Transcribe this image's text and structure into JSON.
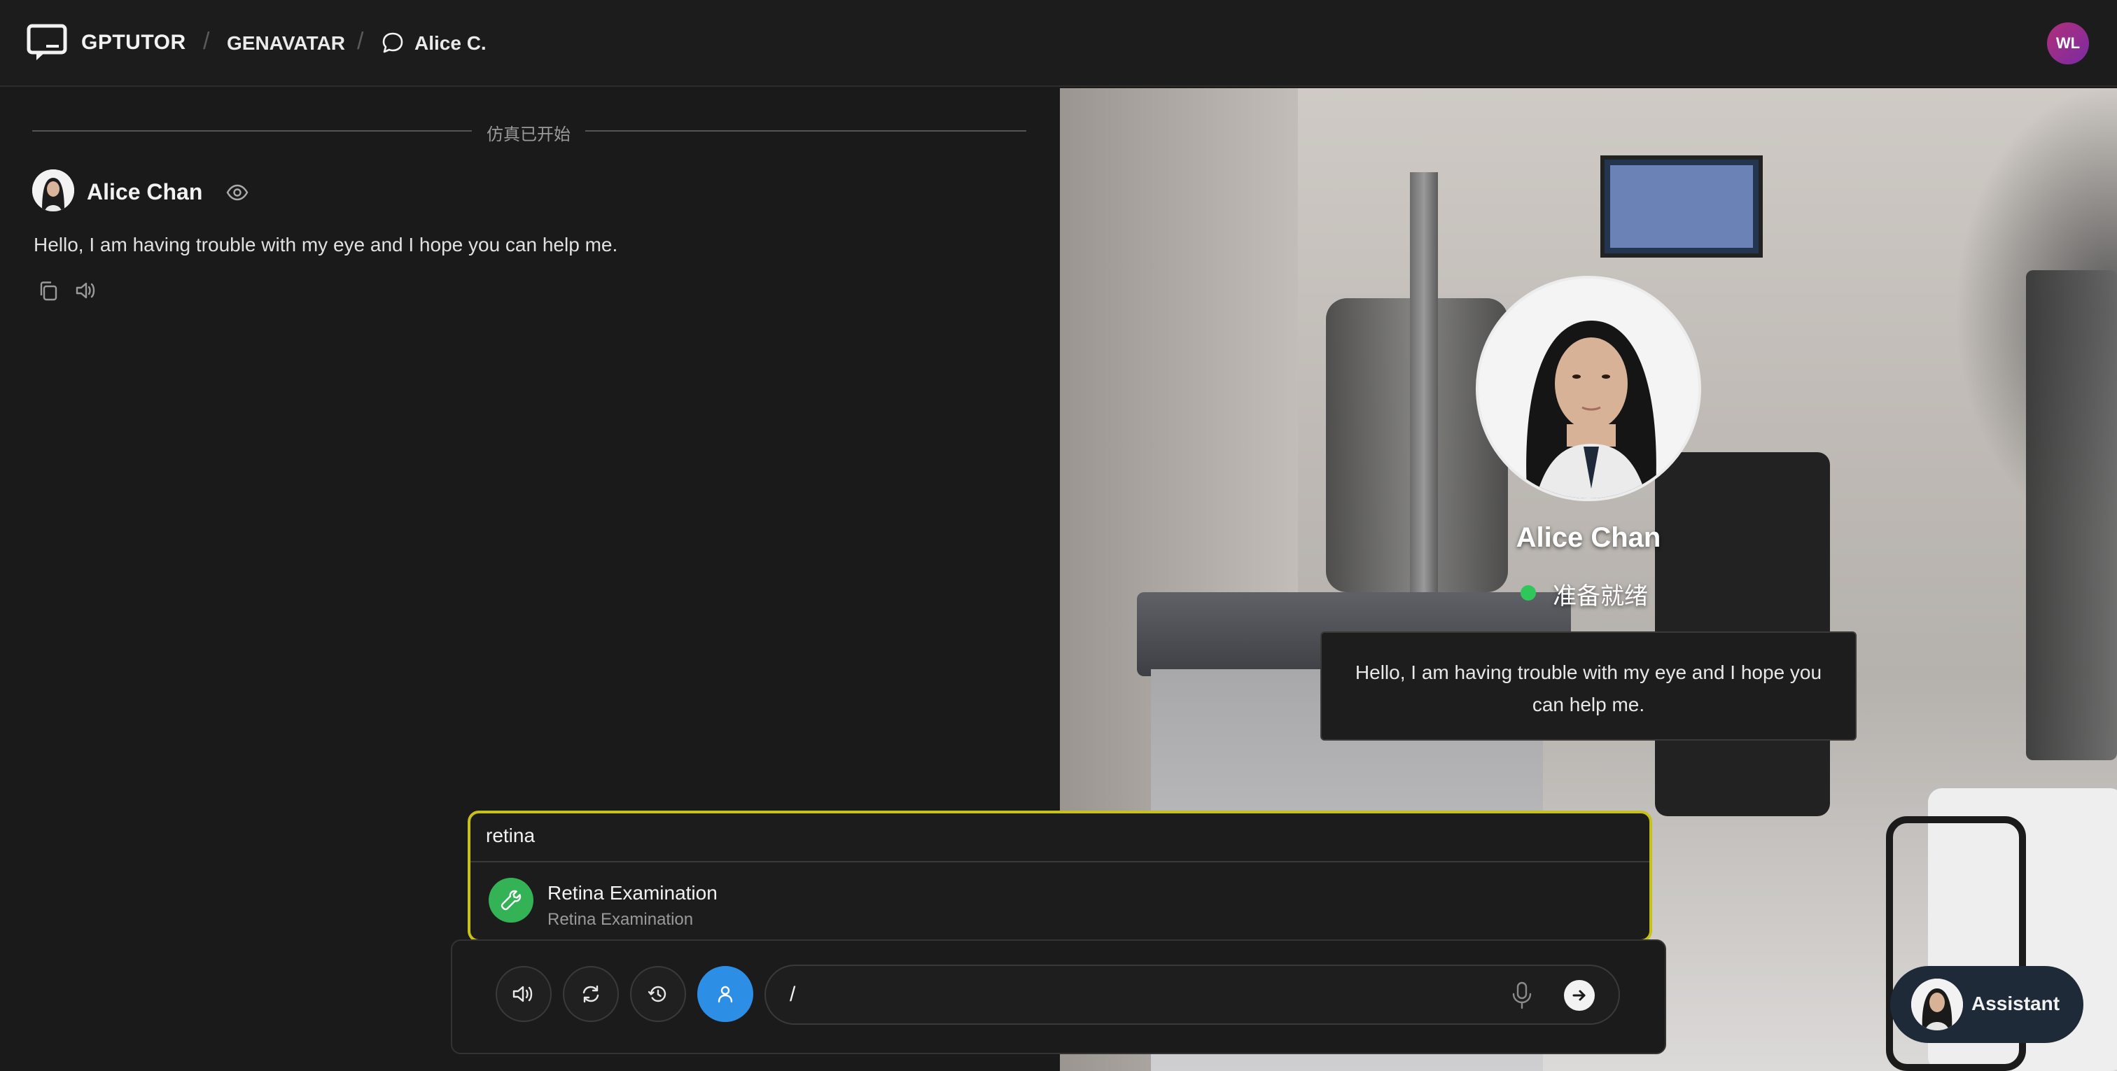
{
  "header": {
    "brand": "GPTUTOR",
    "crumb_module": "GENAVATAR",
    "crumb_chat": "Alice C.",
    "user_initials": "WL"
  },
  "chat": {
    "divider_label": "仿真已开始",
    "messages": [
      {
        "sender": "Alice Chan",
        "text": "Hello, I am having trouble with my eye and I hope you can help me."
      }
    ]
  },
  "avatar_panel": {
    "name": "Alice Chan",
    "status": "准备就绪",
    "status_color": "#2fc75a",
    "speech": "Hello, I am having trouble with my eye and I hope you can help me."
  },
  "command_palette": {
    "query": "retina",
    "results": [
      {
        "title": "Retina Examination",
        "subtitle": "Retina Examination",
        "icon": "wrench-icon"
      }
    ]
  },
  "composer": {
    "value": "/",
    "buttons": [
      "speaker-icon",
      "refresh-icon",
      "history-icon",
      "person-icon"
    ],
    "active_button": "person-icon"
  },
  "assistant": {
    "label": "Assistant"
  },
  "colors": {
    "accent_blue": "#2d8ee6",
    "palette_border": "#c7c21a",
    "tool_green": "#34b356"
  }
}
